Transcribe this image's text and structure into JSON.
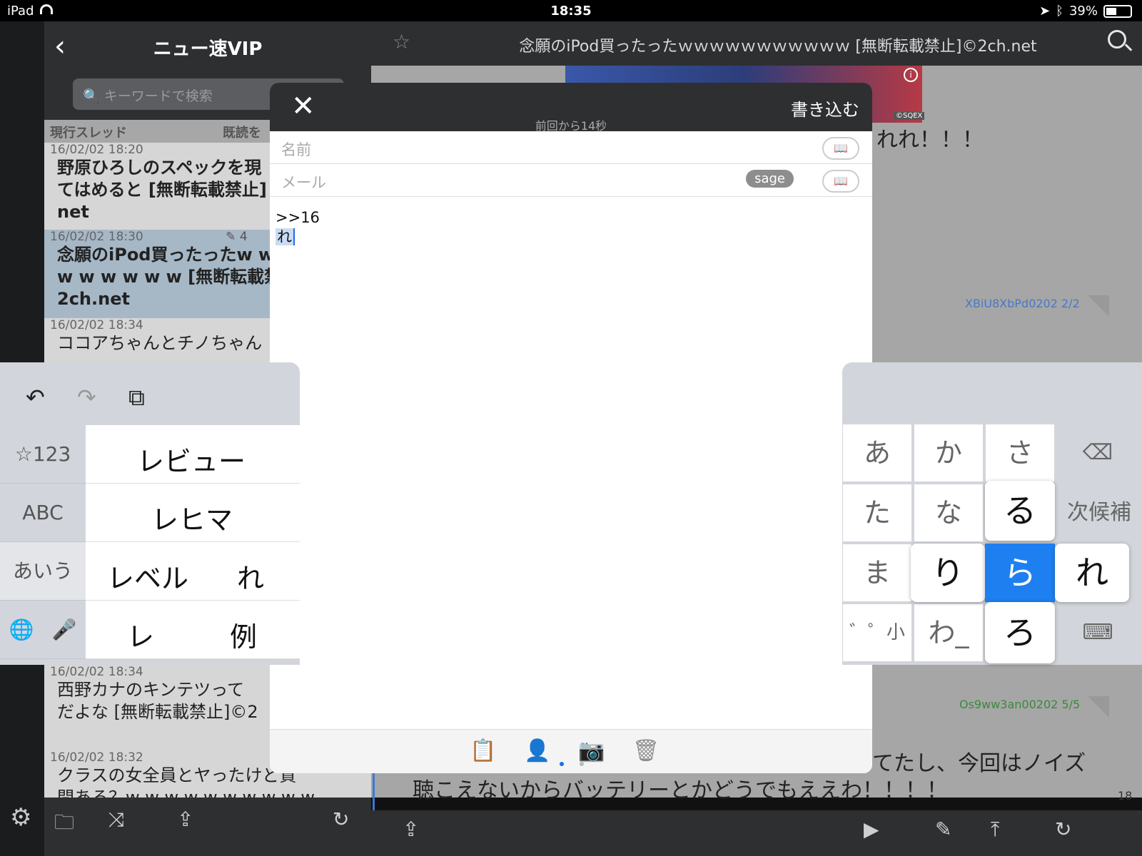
{
  "status": {
    "device": "iPad",
    "time": "18:35",
    "battery": "39%"
  },
  "list": {
    "title": "ニュー速VIP",
    "search_placeholder": "キーワードで検索",
    "section_label": "現行スレッド",
    "section_right": "既読を",
    "threads": [
      {
        "date": "16/02/02 18:20",
        "title": "野原ひろしのスペックを現\nてはめると [無断転載禁止]\nnet"
      },
      {
        "date": "16/02/02 18:30",
        "title": "念願のiPod買ったったw w\nw w w w w w [無断転載禁\n2ch.net",
        "count": "4"
      },
      {
        "date": "16/02/02 18:34",
        "title": "ココアちゃんとチノちゃん"
      },
      {
        "date": "16/02/02 18:34",
        "title": "西野カナのキンテツって\nだよな [無断転載禁止]©2"
      },
      {
        "date": "16/02/02 18:32",
        "title": "クラスの女全員とヤったけど質\n問ある？w w w w w w w w w w"
      }
    ]
  },
  "detail": {
    "title": "念願のiPod買ったったｗｗｗｗｗｗｗｗｗｗｗ [無断転載禁止]©2ch.net",
    "text1": "れれ！！！",
    "id1": "XBiU8XbPd0202 2/2",
    "id2": "Os9ww3an00202 5/5",
    "text2a": "てたし、今回はノイズ",
    "text2b": "聴こえないからバッテリーとかどうでもええわ！！！！",
    "resnum": "18",
    "ad_badge": "i",
    "ad_credit": "©SQEX"
  },
  "compose": {
    "close": "✕",
    "submit": "書き込む",
    "since": "前回から14秒",
    "name_placeholder": "名前",
    "mail_placeholder": "メール",
    "sage": "sage",
    "body_line1": ">>16",
    "body_line2": "れ"
  },
  "candidates": {
    "modes": [
      "☆123",
      "ABC",
      "あいう"
    ],
    "rows": [
      [
        "レビュー"
      ],
      [
        "レヒマ"
      ],
      [
        "レベル",
        "れ"
      ],
      [
        "レ",
        "例"
      ]
    ]
  },
  "keyboard": {
    "row1": [
      "あ",
      "か",
      "さ"
    ],
    "row2": [
      "た",
      "な"
    ],
    "row3": [
      "ま"
    ],
    "row4": [
      "゛゜小",
      "わ_"
    ],
    "next": "次候補",
    "flick": {
      "up": "る",
      "left": "り",
      "center": "ら",
      "right": "れ",
      "down": "ろ"
    }
  },
  "icons": [
    "back-icon",
    "search-icon",
    "star-icon",
    "gear-icon",
    "folder-icon",
    "shuffle-icon",
    "share-icon",
    "reload-icon",
    "play-icon",
    "compose-icon",
    "top-icon",
    "undo-icon",
    "redo-icon",
    "paste-icon",
    "globe-icon",
    "mic-icon",
    "backspace-icon",
    "keyboard-hide-icon",
    "clipboard-icon",
    "user-icon",
    "camera-icon",
    "trash-icon",
    "book-icon"
  ]
}
